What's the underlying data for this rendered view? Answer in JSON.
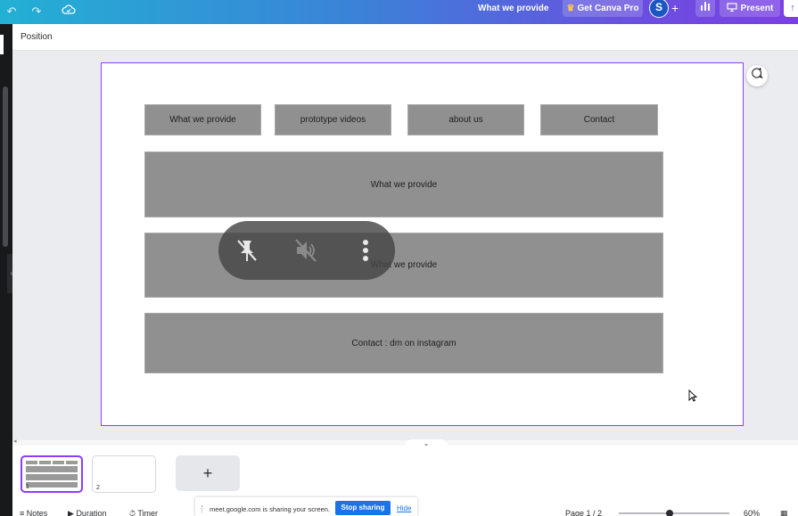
{
  "topbar": {
    "undo_icon": "undo-icon",
    "redo_icon": "redo-icon",
    "cloud_icon": "cloud-saved-icon",
    "doc_title": "What we provide",
    "get_pro_label": "Get Canva Pro",
    "avatar_initial": "S",
    "present_label": "Present"
  },
  "context_toolbar": {
    "position_label": "Position"
  },
  "design": {
    "nav_buttons": [
      {
        "label": "What we provide"
      },
      {
        "label": "prototype videos"
      },
      {
        "label": "about us"
      },
      {
        "label": "Contact"
      }
    ],
    "blocks": [
      {
        "label": "What we provide"
      },
      {
        "label": "What we provide"
      },
      {
        "label": "Contact : dm on instagram"
      }
    ],
    "selection_color": "#8b3dff",
    "box_color": "#909090"
  },
  "meet_overlay": {
    "icons": [
      "unpin-icon",
      "mute-icon",
      "more-options-icon"
    ]
  },
  "pages": {
    "thumbnails": [
      {
        "number": "1",
        "active": true
      },
      {
        "number": "2",
        "active": false
      }
    ],
    "add_label": "+"
  },
  "statusbar": {
    "notes_label": "Notes",
    "duration_label": "Duration",
    "timer_label": "Timer",
    "page_indicator": "Page 1 / 2",
    "zoom_value": "60%"
  },
  "screen_share": {
    "message": "meet.google.com is sharing your screen.",
    "stop_label": "Stop sharing",
    "hide_label": "Hide"
  }
}
